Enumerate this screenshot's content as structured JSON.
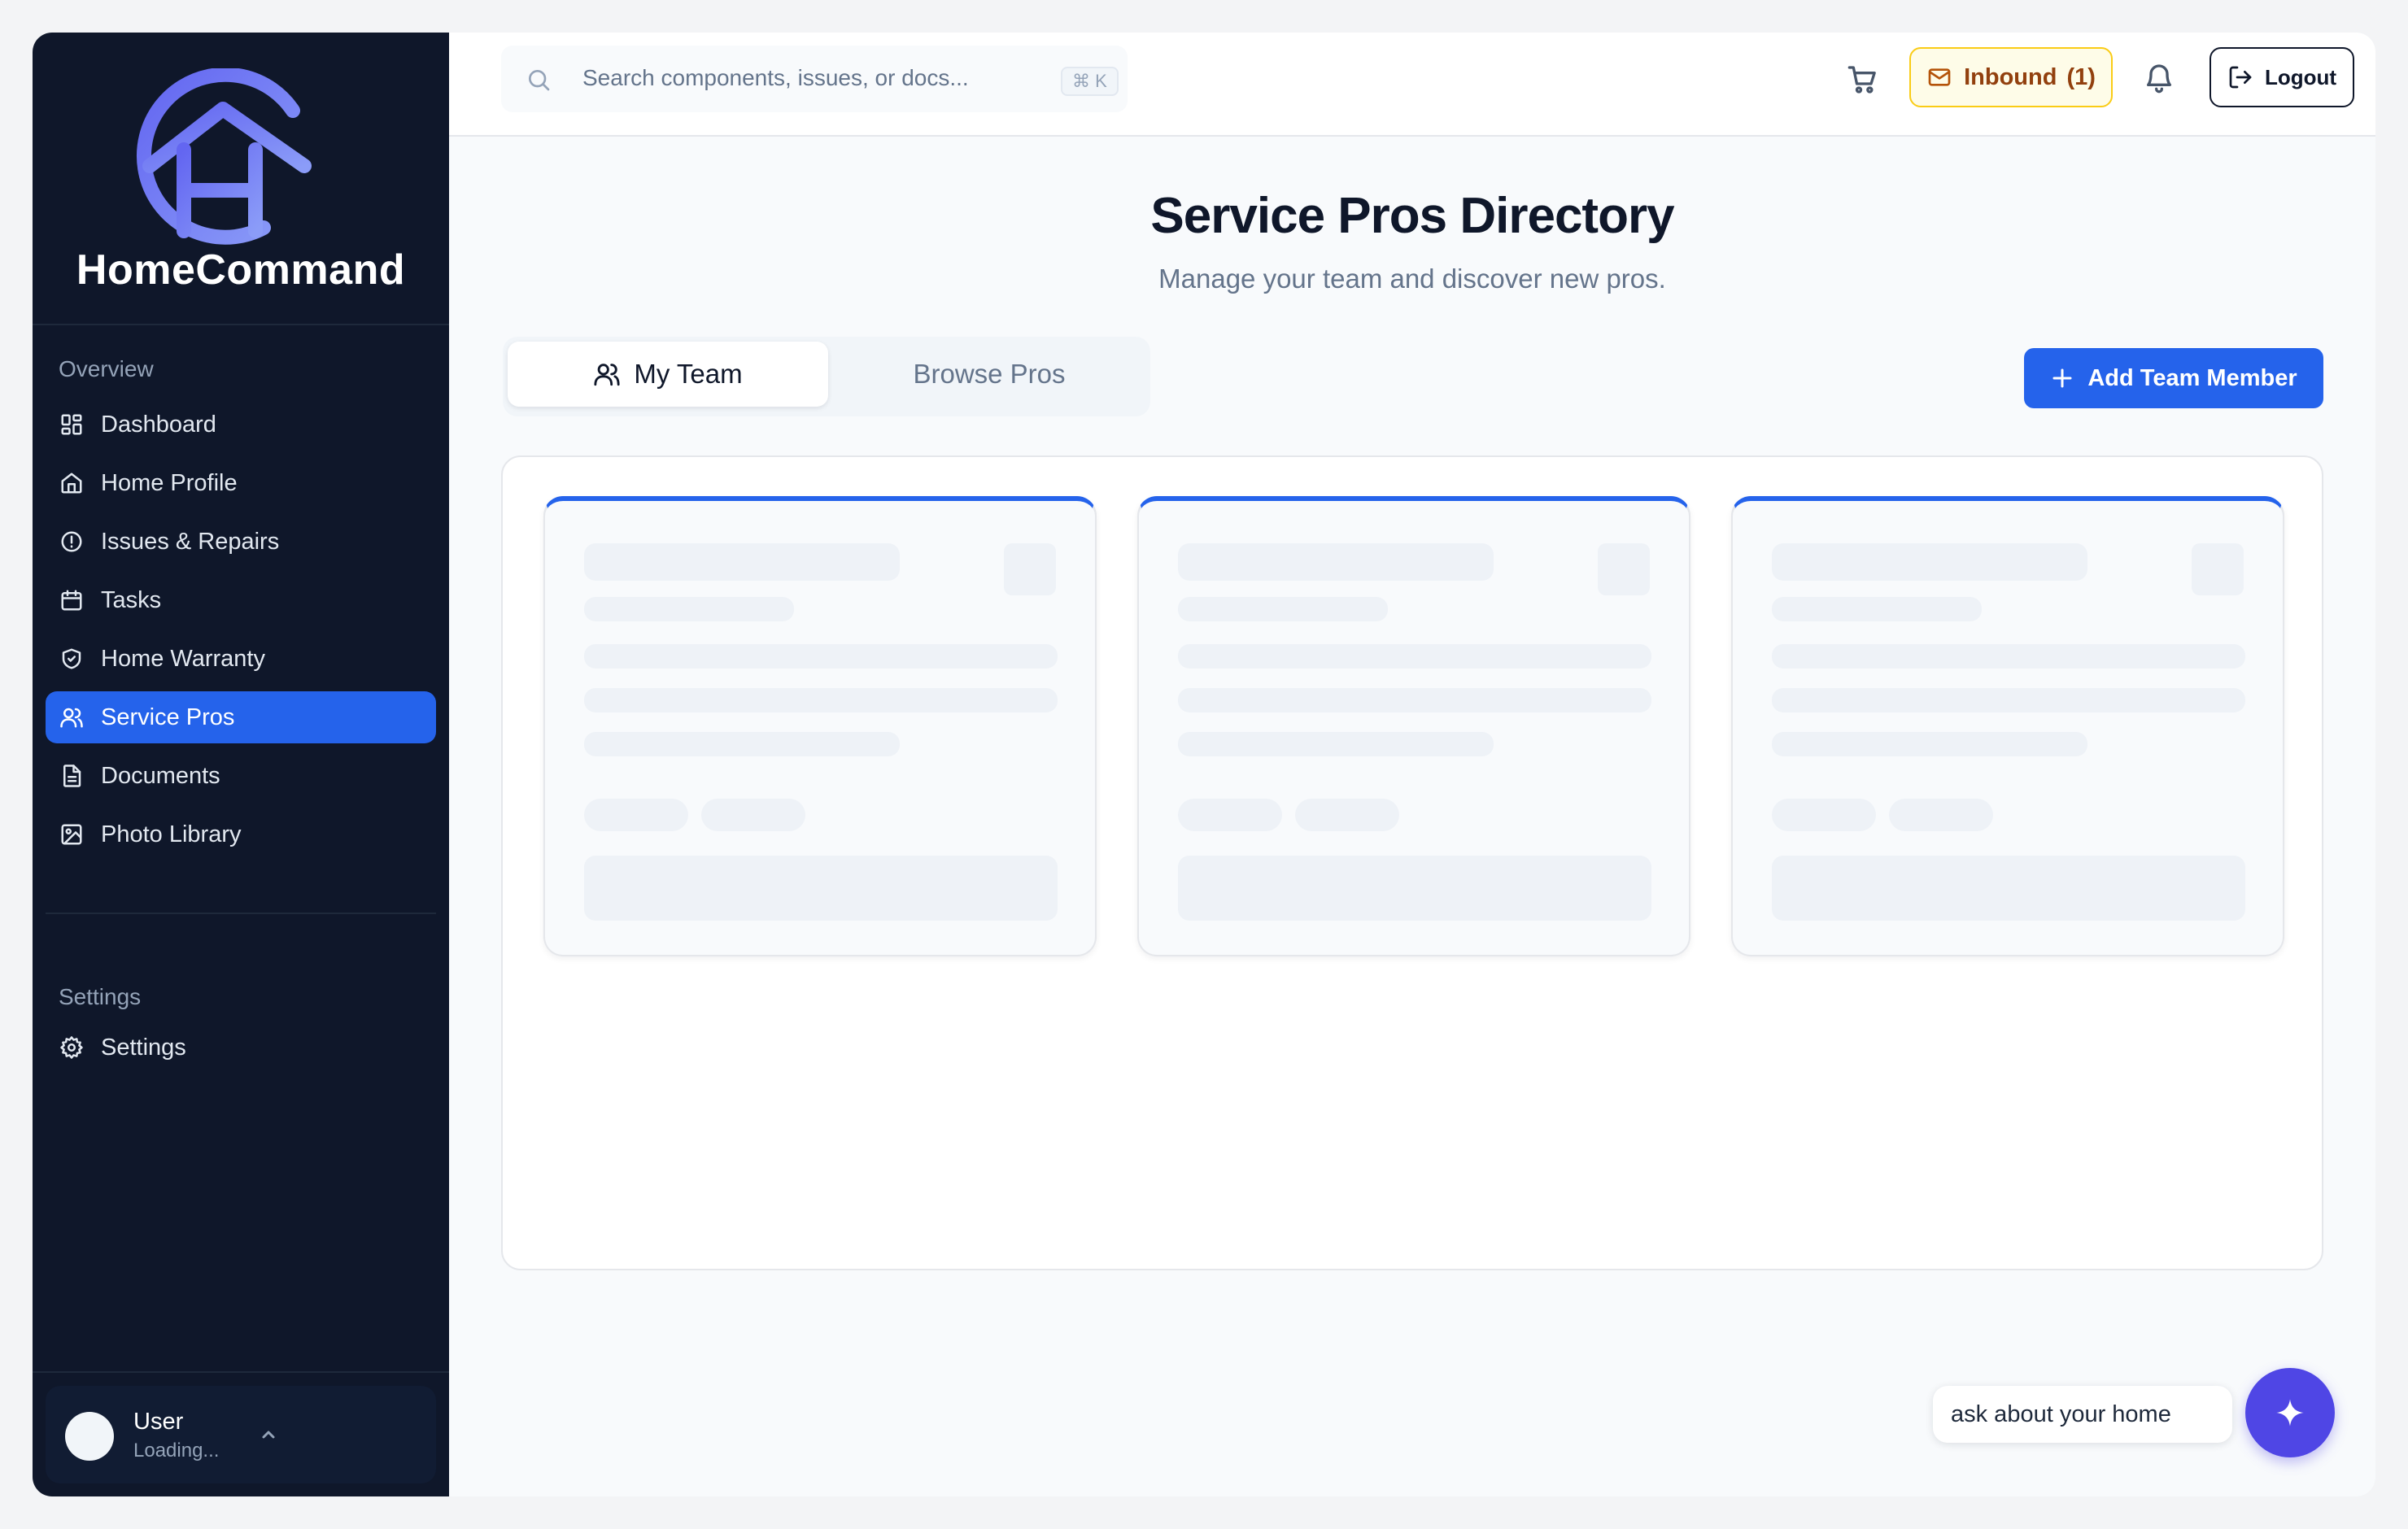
{
  "brand": {
    "name": "HomeCommand"
  },
  "sidebar": {
    "overview_label": "Overview",
    "items": [
      {
        "label": "Dashboard",
        "icon": "dashboard-icon"
      },
      {
        "label": "Home Profile",
        "icon": "home-icon"
      },
      {
        "label": "Issues & Repairs",
        "icon": "alert-circle-icon"
      },
      {
        "label": "Tasks",
        "icon": "calendar-icon"
      },
      {
        "label": "Home Warranty",
        "icon": "shield-check-icon"
      },
      {
        "label": "Service Pros",
        "icon": "users-icon",
        "active": true
      },
      {
        "label": "Documents",
        "icon": "document-icon"
      },
      {
        "label": "Photo Library",
        "icon": "image-icon"
      }
    ],
    "settings_label": "Settings",
    "settings_item": {
      "label": "Settings",
      "icon": "gear-icon"
    },
    "user": {
      "name": "User",
      "status": "Loading..."
    }
  },
  "topbar": {
    "search_placeholder": "Search components, issues, or docs...",
    "shortcut": "⌘ K",
    "inbound_label": "Inbound",
    "inbound_count": "(1)",
    "logout_label": "Logout"
  },
  "main": {
    "title": "Service Pros Directory",
    "subtitle": "Manage your team and discover new pros.",
    "tabs": [
      {
        "label": "My Team",
        "active": true
      },
      {
        "label": "Browse Pros",
        "active": false
      }
    ],
    "add_button_label": "Add Team Member",
    "loading_cards": 3
  },
  "assistant": {
    "prompt": "ask about your home"
  },
  "colors": {
    "sidebar_bg": "#0f172a",
    "accent": "#2563eb",
    "brand_gradient_start": "#6366f1",
    "brand_gradient_end": "#818cf8",
    "inbound_bg": "#fefce8",
    "inbound_border": "#facc15",
    "fab": "#4f46e5"
  }
}
